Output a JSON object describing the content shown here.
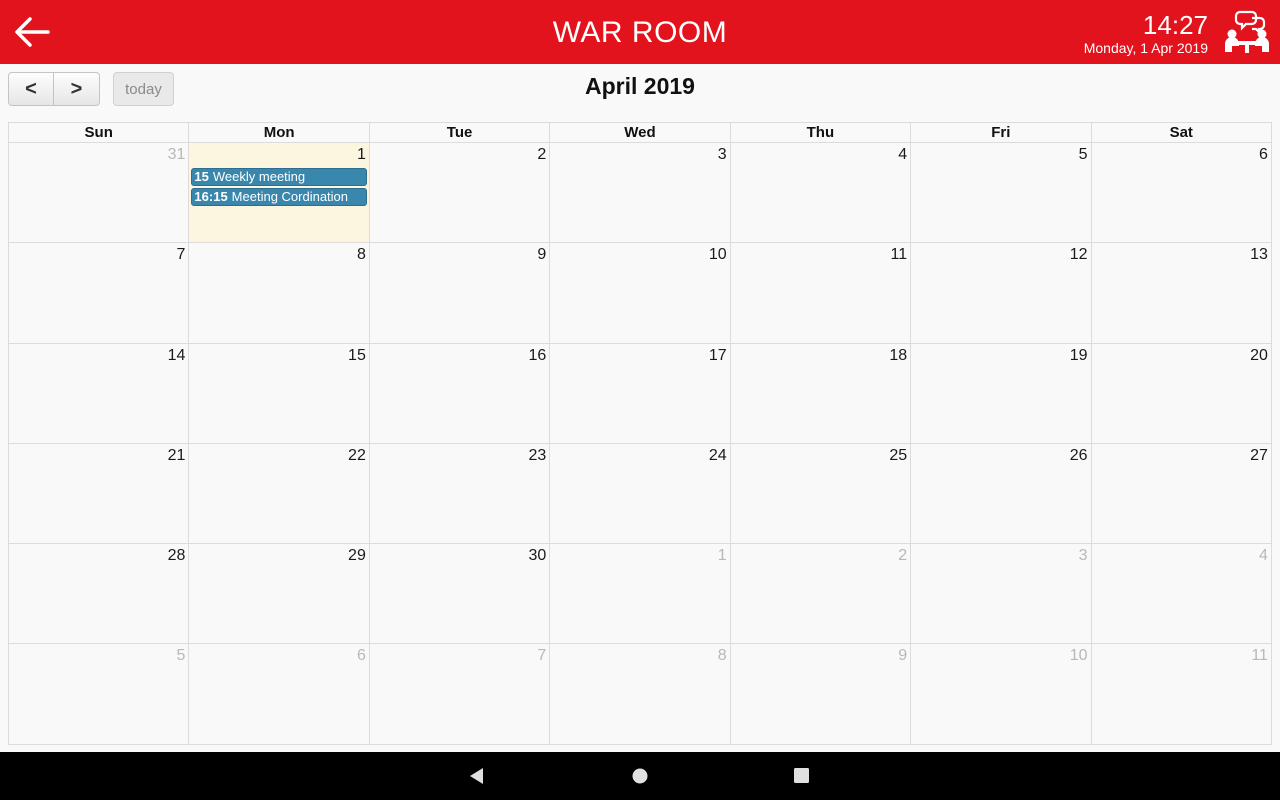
{
  "header": {
    "title": "WAR ROOM",
    "time": "14:27",
    "date": "Monday, 1 Apr 2019",
    "icon": "meeting-room-icon",
    "back_icon": "arrow-left-icon"
  },
  "toolbar": {
    "prev_label": "<",
    "next_label": ">",
    "today_label": "today",
    "month_title": "April 2019"
  },
  "weekdays": [
    "Sun",
    "Mon",
    "Tue",
    "Wed",
    "Thu",
    "Fri",
    "Sat"
  ],
  "weeks": [
    [
      {
        "n": "31",
        "other": true
      },
      {
        "n": "1",
        "today": true,
        "events": [
          {
            "time": "15",
            "title": "Weekly meeting"
          },
          {
            "time": "16:15",
            "title": "Meeting Cordination"
          }
        ]
      },
      {
        "n": "2"
      },
      {
        "n": "3"
      },
      {
        "n": "4"
      },
      {
        "n": "5"
      },
      {
        "n": "6"
      }
    ],
    [
      {
        "n": "7"
      },
      {
        "n": "8"
      },
      {
        "n": "9"
      },
      {
        "n": "10"
      },
      {
        "n": "11"
      },
      {
        "n": "12"
      },
      {
        "n": "13"
      }
    ],
    [
      {
        "n": "14"
      },
      {
        "n": "15"
      },
      {
        "n": "16"
      },
      {
        "n": "17"
      },
      {
        "n": "18"
      },
      {
        "n": "19"
      },
      {
        "n": "20"
      }
    ],
    [
      {
        "n": "21"
      },
      {
        "n": "22"
      },
      {
        "n": "23"
      },
      {
        "n": "24"
      },
      {
        "n": "25"
      },
      {
        "n": "26"
      },
      {
        "n": "27"
      }
    ],
    [
      {
        "n": "28"
      },
      {
        "n": "29"
      },
      {
        "n": "30"
      },
      {
        "n": "1",
        "other": true
      },
      {
        "n": "2",
        "other": true
      },
      {
        "n": "3",
        "other": true
      },
      {
        "n": "4",
        "other": true
      }
    ],
    [
      {
        "n": "5",
        "other": true
      },
      {
        "n": "6",
        "other": true
      },
      {
        "n": "7",
        "other": true
      },
      {
        "n": "8",
        "other": true
      },
      {
        "n": "9",
        "other": true
      },
      {
        "n": "10",
        "other": true
      },
      {
        "n": "11",
        "other": true
      }
    ]
  ],
  "colors": {
    "header_red": "#e3131d",
    "event_blue": "#3a87ad",
    "today_bg": "#fcf6e1",
    "other_month_text": "#b8b8b8"
  },
  "system_nav": {
    "back_icon": "nav-back-triangle-icon",
    "home_icon": "nav-home-circle-icon",
    "recents_icon": "nav-recents-square-icon"
  }
}
